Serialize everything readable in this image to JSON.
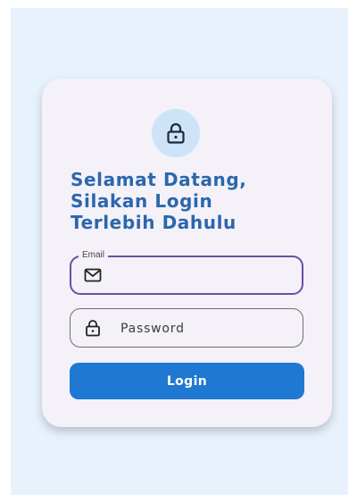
{
  "welcome": {
    "line1": "Selamat Datang,",
    "line2": "Silakan Login",
    "line3": "Terlebih Dahulu"
  },
  "form": {
    "email_label": "Email",
    "email_value": "",
    "password_placeholder": "Password",
    "login_label": "Login"
  },
  "icons": {
    "header": "lock-icon",
    "email": "mail-icon",
    "password": "lock-icon"
  },
  "colors": {
    "background": "#e8f2fc",
    "card": "#f4f1f8",
    "heading": "#2b67ad",
    "badge": "#cde4f8",
    "email_border_focused": "#6a4fa0",
    "primary_button": "#1f78d1"
  }
}
